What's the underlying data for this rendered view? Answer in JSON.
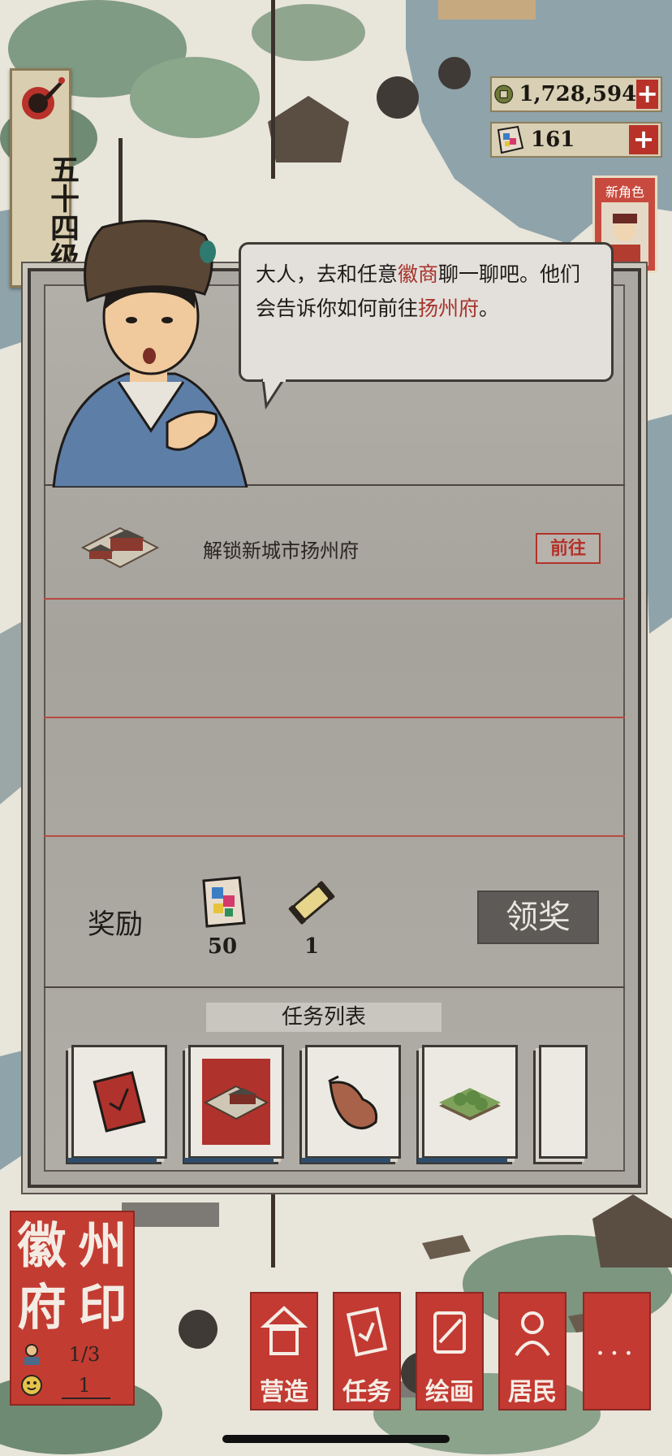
{
  "player": {
    "level_text": "五十四级"
  },
  "currency": {
    "coins": "1,728,594",
    "tickets": "161",
    "plus_label": "+"
  },
  "new_character": {
    "label": "新角色"
  },
  "dialog": {
    "part1": "大人，去和任意",
    "highlight1": "徽商",
    "part2": "聊一聊吧。他们会告诉你如何前往",
    "highlight2": "扬州府",
    "part3": "。"
  },
  "quest": {
    "text": "解锁新城市扬州府",
    "goto_label": "前往"
  },
  "reward": {
    "label": "奖励",
    "items": [
      {
        "icon": "colorful-ticket-icon",
        "qty": "50"
      },
      {
        "icon": "scroll-icon",
        "qty": "1"
      }
    ],
    "claim_label": "领奖"
  },
  "task_list": {
    "title": "任务列表",
    "cards": [
      {
        "icon": "red-book-icon",
        "active": false
      },
      {
        "icon": "building-icon",
        "active": true
      },
      {
        "icon": "leather-pouch-icon",
        "active": false
      },
      {
        "icon": "field-plot-icon",
        "active": false
      }
    ]
  },
  "seal": {
    "chars": [
      "徽",
      "州",
      "府",
      "印"
    ],
    "count1": "1/3",
    "count2": "1"
  },
  "menu": [
    {
      "label": "营造",
      "icon": "pavilion-icon"
    },
    {
      "label": "任务",
      "icon": "task-book-icon"
    },
    {
      "label": "绘画",
      "icon": "painting-scroll-icon"
    },
    {
      "label": "居民",
      "icon": "resident-icon"
    },
    {
      "label": "···",
      "icon": "more-icon"
    }
  ],
  "colors": {
    "accent_red": "#c23a32",
    "panel_gray": "#aaa6a0",
    "highlight_text": "#a7332b"
  }
}
